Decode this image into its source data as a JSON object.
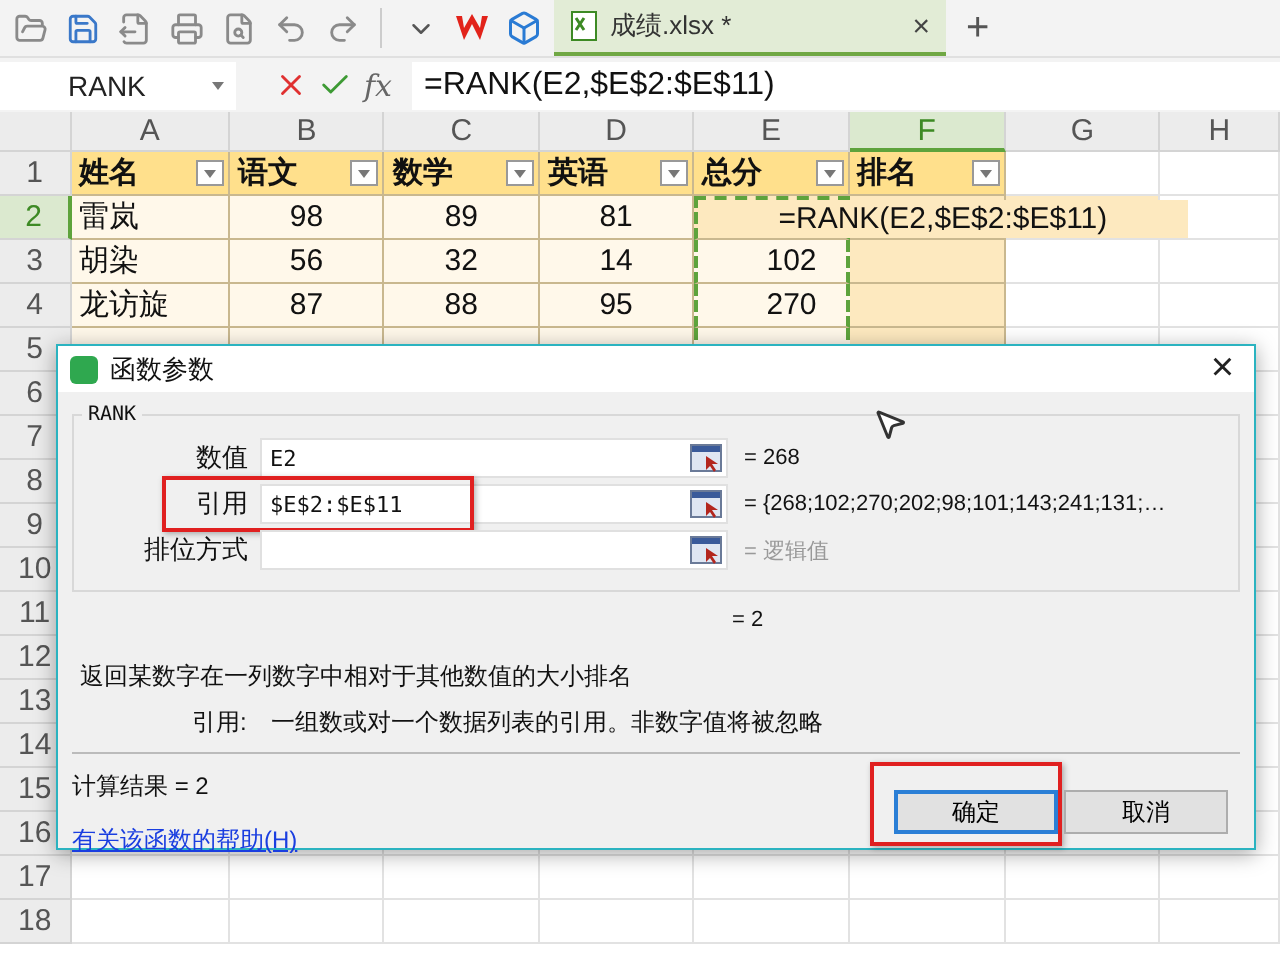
{
  "toolbar": {
    "tab": {
      "title": "成绩.xlsx *",
      "close": "×"
    },
    "new_tab": "+"
  },
  "formula_bar": {
    "name_box": "RANK",
    "fx": "fx",
    "formula": "=RANK(E2,$E$2:$E$11)"
  },
  "columns": [
    {
      "label": "A",
      "selected": false
    },
    {
      "label": "B",
      "selected": false
    },
    {
      "label": "C",
      "selected": false
    },
    {
      "label": "D",
      "selected": false
    },
    {
      "label": "E",
      "selected": false
    },
    {
      "label": "F",
      "selected": true
    },
    {
      "label": "G",
      "selected": false
    },
    {
      "label": "H",
      "selected": false
    }
  ],
  "rows": [
    {
      "number": "1",
      "selected": false,
      "kind": "header",
      "cells": [
        "姓名",
        "语文",
        "数学",
        "英语",
        "总分",
        "排名"
      ]
    },
    {
      "number": "2",
      "selected": true,
      "kind": "editing",
      "cells": [
        "雷岚",
        "98",
        "89",
        "81",
        "=RANK(E2,$E$2:$E$11)"
      ]
    },
    {
      "number": "3",
      "selected": false,
      "kind": "data",
      "cells": [
        "胡染",
        "56",
        "32",
        "14",
        "102"
      ]
    },
    {
      "number": "4",
      "selected": false,
      "kind": "data",
      "cells": [
        "龙访旋",
        "87",
        "88",
        "95",
        "270"
      ]
    },
    {
      "number": "5",
      "selected": false,
      "kind": "data",
      "cells": []
    },
    {
      "number": "6",
      "selected": false,
      "kind": "covered",
      "cells": []
    },
    {
      "number": "7",
      "selected": false,
      "kind": "covered",
      "cells": []
    },
    {
      "number": "8",
      "selected": false,
      "kind": "covered",
      "cells": []
    },
    {
      "number": "9",
      "selected": false,
      "kind": "covered",
      "cells": []
    },
    {
      "number": "10",
      "selected": false,
      "kind": "covered",
      "cells": []
    },
    {
      "number": "11",
      "selected": false,
      "kind": "covered",
      "cells": []
    },
    {
      "number": "12",
      "selected": false,
      "kind": "covered",
      "cells": []
    },
    {
      "number": "13",
      "selected": false,
      "kind": "covered",
      "cells": []
    },
    {
      "number": "14",
      "selected": false,
      "kind": "covered",
      "cells": []
    },
    {
      "number": "15",
      "selected": false,
      "kind": "covered",
      "cells": []
    },
    {
      "number": "16",
      "selected": false,
      "kind": "covered",
      "cells": []
    },
    {
      "number": "17",
      "selected": false,
      "kind": "blank",
      "cells": []
    },
    {
      "number": "18",
      "selected": false,
      "kind": "blank",
      "cells": []
    }
  ],
  "dialog": {
    "title": "函数参数",
    "close": "×",
    "group": "RANK",
    "arguments": [
      {
        "label": "数值",
        "value": "E2",
        "result": "= 268",
        "muted": false,
        "highlighted": false
      },
      {
        "label": "引用",
        "value": "$E$2:$E$11",
        "result": "= {268;102;270;202;98;101;143;241;131;…",
        "muted": false,
        "highlighted": true
      },
      {
        "label": "排位方式",
        "result": "= 逻辑值",
        "muted": true,
        "highlighted": false
      }
    ],
    "formula_result": "= 2",
    "description": "返回某数字在一列数字中相对于其他数值的大小排名",
    "argument_help": {
      "label": "引用:",
      "text": "一组数或对一个数据列表的引用。非数字值将被忽略"
    },
    "calc_result": "计算结果 = 2",
    "help_link": "有关该函数的帮助(H)",
    "buttons": [
      {
        "label": "确定",
        "default": true,
        "highlighted": true
      },
      {
        "label": "取消",
        "default": false,
        "highlighted": false
      }
    ]
  }
}
